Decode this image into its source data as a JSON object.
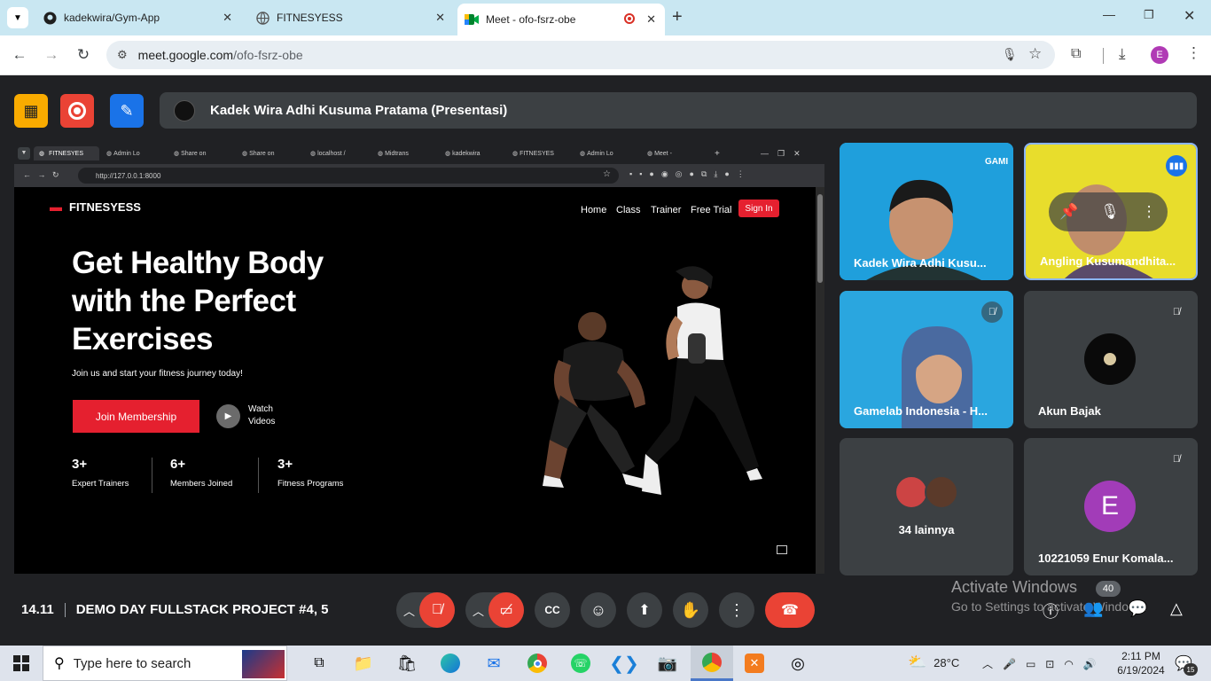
{
  "browser": {
    "tabs": [
      {
        "title": "kadekwira/Gym-App",
        "icon": "github-icon"
      },
      {
        "title": "FITNESYESS",
        "icon": "globe-icon"
      },
      {
        "title": "Meet - ofo-fsrz-obe",
        "icon": "meet-icon",
        "active": true
      }
    ],
    "url_host": "meet.google.com",
    "url_path": "/ofo-fsrz-obe",
    "profile_initial": "E"
  },
  "meet": {
    "presenter_label": "Kadek Wira Adhi Kusuma Pratama (Presentasi)",
    "time": "14.11",
    "meeting_title": "DEMO DAY FULLSTACK PROJECT #4, 5",
    "participant_count": "40",
    "participants": [
      {
        "name": "Kadek Wira Adhi Kusu..."
      },
      {
        "name": "Angling Kusumandhita..."
      },
      {
        "name": "Gamelab Indonesia - H..."
      },
      {
        "name": "Akun Bajak"
      },
      {
        "name": "34 lainnya"
      },
      {
        "name": "10221059 Enur Komala...",
        "initial": "E"
      }
    ],
    "activate_title": "Activate Windows",
    "activate_sub": "Go to Settings to activate Windows."
  },
  "shared_screen": {
    "tabs": [
      "FITNESYES",
      "Admin Lo",
      "Share on",
      "Share on",
      "localhost /",
      "Midtrans",
      "kadekwira",
      "FITNESYES",
      "Admin Lo",
      "Meet -"
    ],
    "url": "http://127.0.0.1:8000",
    "site": {
      "brand": "FITNESYESS",
      "nav": [
        "Home",
        "Class",
        "Trainer",
        "Free Trial"
      ],
      "signin": "Sign In",
      "hero_line1": "Get Healthy Body",
      "hero_line2": "with the Perfect",
      "hero_line3": "Exercises",
      "subtitle": "Join us and start your fitness journey today!",
      "cta": "Join Membership",
      "watch1": "Watch",
      "watch2": "Videos",
      "stats": [
        {
          "num": "3+",
          "label": "Expert Trainers"
        },
        {
          "num": "6+",
          "label": "Members Joined"
        },
        {
          "num": "3+",
          "label": "Fitness Programs"
        }
      ],
      "accent": "#e5202f"
    }
  },
  "taskbar": {
    "search_placeholder": "Type here to search",
    "weather": "28°C",
    "time": "2:11 PM",
    "date": "6/19/2024",
    "notif_count": "15"
  }
}
